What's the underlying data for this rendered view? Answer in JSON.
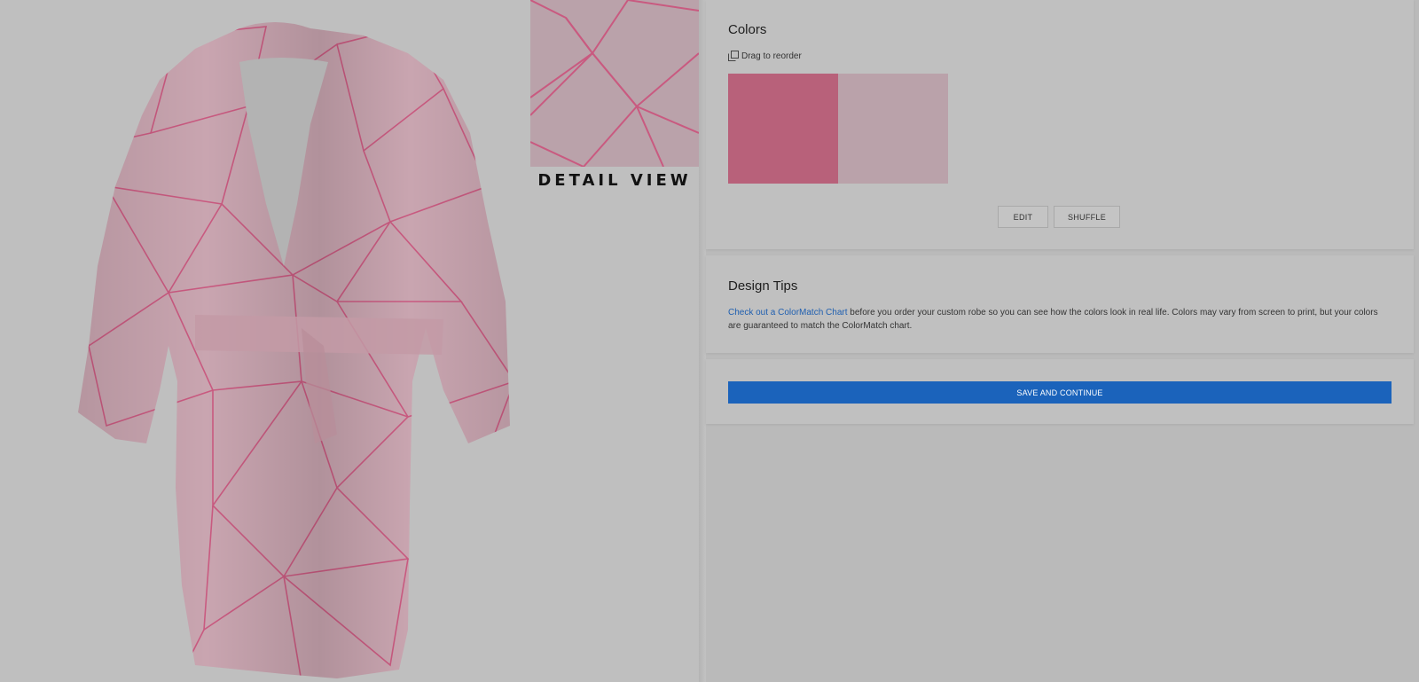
{
  "preview": {
    "detail_label": "DETAIL VIEW",
    "robe_base_color": "#c9a5b0",
    "pattern_line_color": "#c95a80"
  },
  "colors_card": {
    "title": "Colors",
    "drag_hint": "Drag to reorder",
    "drag_icon": "copy-icon",
    "swatches": [
      {
        "color": "#b8617a"
      },
      {
        "color": "#baa2aa"
      }
    ],
    "edit_label": "EDIT",
    "shuffle_label": "SHUFFLE"
  },
  "tips_card": {
    "title": "Design Tips",
    "link_text": "Check out a ColorMatch Chart",
    "body_text": " before you order your custom robe so you can see how the colors look in real life. Colors may vary from screen to print, but your colors are guaranteed to match the ColorMatch chart."
  },
  "save_card": {
    "save_label": "SAVE AND CONTINUE"
  },
  "theme": {
    "primary_button": "#1b63bb",
    "link": "#1f5fb0"
  }
}
